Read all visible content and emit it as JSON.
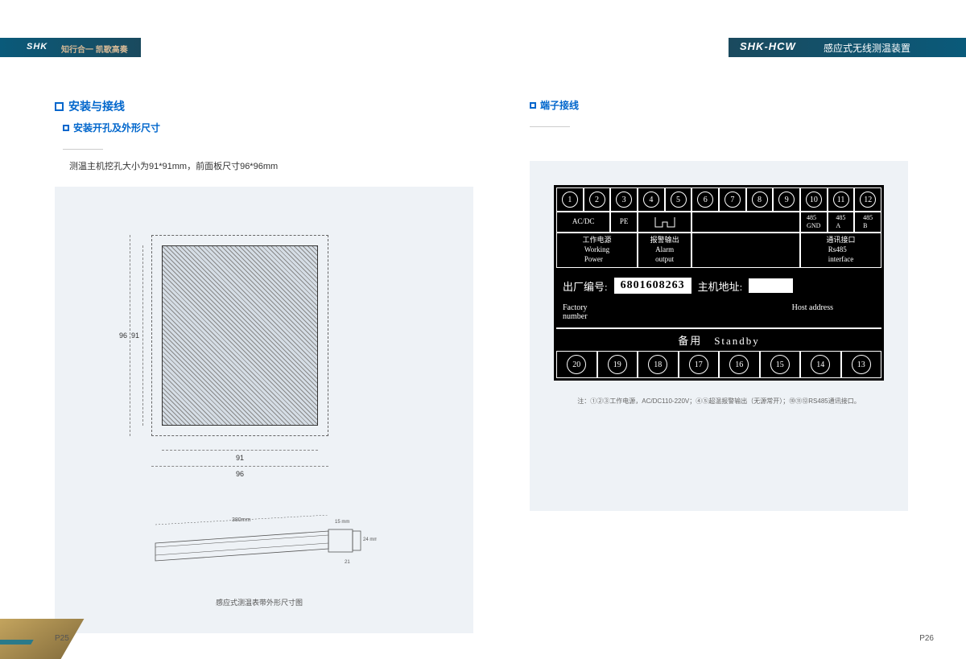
{
  "header": {
    "brand": "SHK",
    "slogan": "知行合一 凯歌高奏",
    "model": "SHK-HCW",
    "product": "感应式无线测温装置"
  },
  "left": {
    "h1": "安装与接线",
    "h2": "安装开孔及外形尺寸",
    "desc": "测温主机挖孔大小为91*91mm，前面板尺寸96*96mm",
    "d91": "91",
    "d96": "96",
    "d91h": "91",
    "d96h": "96",
    "belt_len": "380mm",
    "belt_w": "15 mm",
    "belt_h": "24 mm",
    "belt_h2": "21",
    "caption": "感应式测温表带外形尺寸图"
  },
  "right": {
    "h2": "端子接线",
    "top_nums": [
      "1",
      "2",
      "3",
      "4",
      "5",
      "6",
      "7",
      "8",
      "9",
      "10",
      "11",
      "12"
    ],
    "r2": {
      "acdc": "AC/DC",
      "pe": "PE",
      "gnd": "485\nGND",
      "a": "485\nA",
      "b": "485\nB"
    },
    "r3": {
      "wp_cn": "工作电源",
      "wp_en": "Working\nPower",
      "al_cn": "报警输出",
      "al_en": "Alarm\noutput",
      "ci_cn": "通讯接口",
      "ci_en": "Rs485\ninterface"
    },
    "factory_lbl": "出厂编号:",
    "factory_num": "6801608263",
    "host_lbl": "主机地址:",
    "factory_en": "Factory\nnumber",
    "host_en": "Host address",
    "standby": "备用　Standby",
    "bot_nums": [
      "20",
      "19",
      "18",
      "17",
      "16",
      "15",
      "14",
      "13"
    ],
    "note": "注：①②③工作电源，AC/DC110-220V；④⑤超温报警输出（无源常开）；⑩⑪⑫RS485通讯接口。"
  },
  "pages": {
    "l": "P25",
    "r": "P26"
  }
}
